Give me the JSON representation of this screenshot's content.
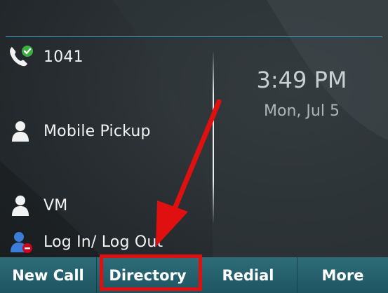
{
  "lines": [
    {
      "label": "1041",
      "icon": "phone-registered-icon"
    },
    {
      "label": "Mobile Pickup",
      "icon": "user-icon"
    },
    {
      "label": "VM",
      "icon": "user-icon"
    },
    {
      "label": "Log In/ Log Out",
      "icon": "user-blocked-icon"
    }
  ],
  "clock": {
    "time": "3:49 PM",
    "date": "Mon, Jul 5"
  },
  "softkeys": [
    {
      "label": "New Call"
    },
    {
      "label": "Directory"
    },
    {
      "label": "Redial"
    },
    {
      "label": "More"
    }
  ],
  "colors": {
    "accent_line": "#3fa9c9",
    "softkey_bar": "#2e6d79",
    "annotation": "#e01010",
    "registered_badge": "#3cb043",
    "blocked_badge": "#d0021b"
  }
}
